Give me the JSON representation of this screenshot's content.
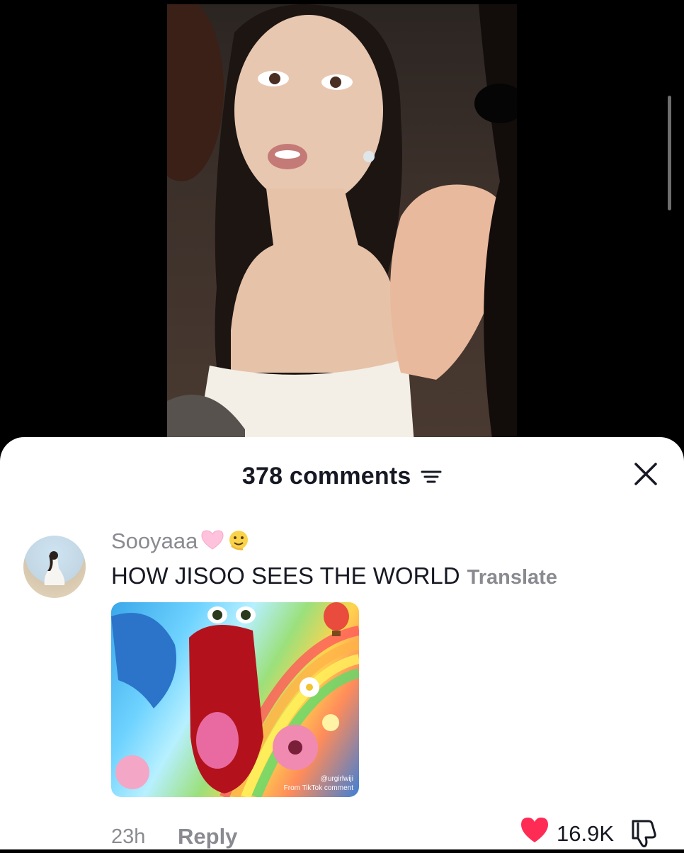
{
  "sheet": {
    "comment_count": "378",
    "comments_label": "comments",
    "title": "378 comments"
  },
  "comment": {
    "username": "Sooyaaa",
    "text": "HOW JISOO SEES THE WORLD",
    "translate_label": "Translate",
    "sticker_watermark_user": "@urgirlwiji",
    "sticker_watermark_source": "From TikTok comment",
    "time": "23h",
    "reply_label": "Reply",
    "like_count": "16.9K"
  },
  "colors": {
    "like_heart": "#fe2c55",
    "secondary_text": "#8a8b91",
    "primary_text": "#161823"
  },
  "icons": [
    "sort-icon",
    "close-icon",
    "heart-icon",
    "dislike-icon",
    "pink-heart-emoji",
    "face-emoji"
  ]
}
